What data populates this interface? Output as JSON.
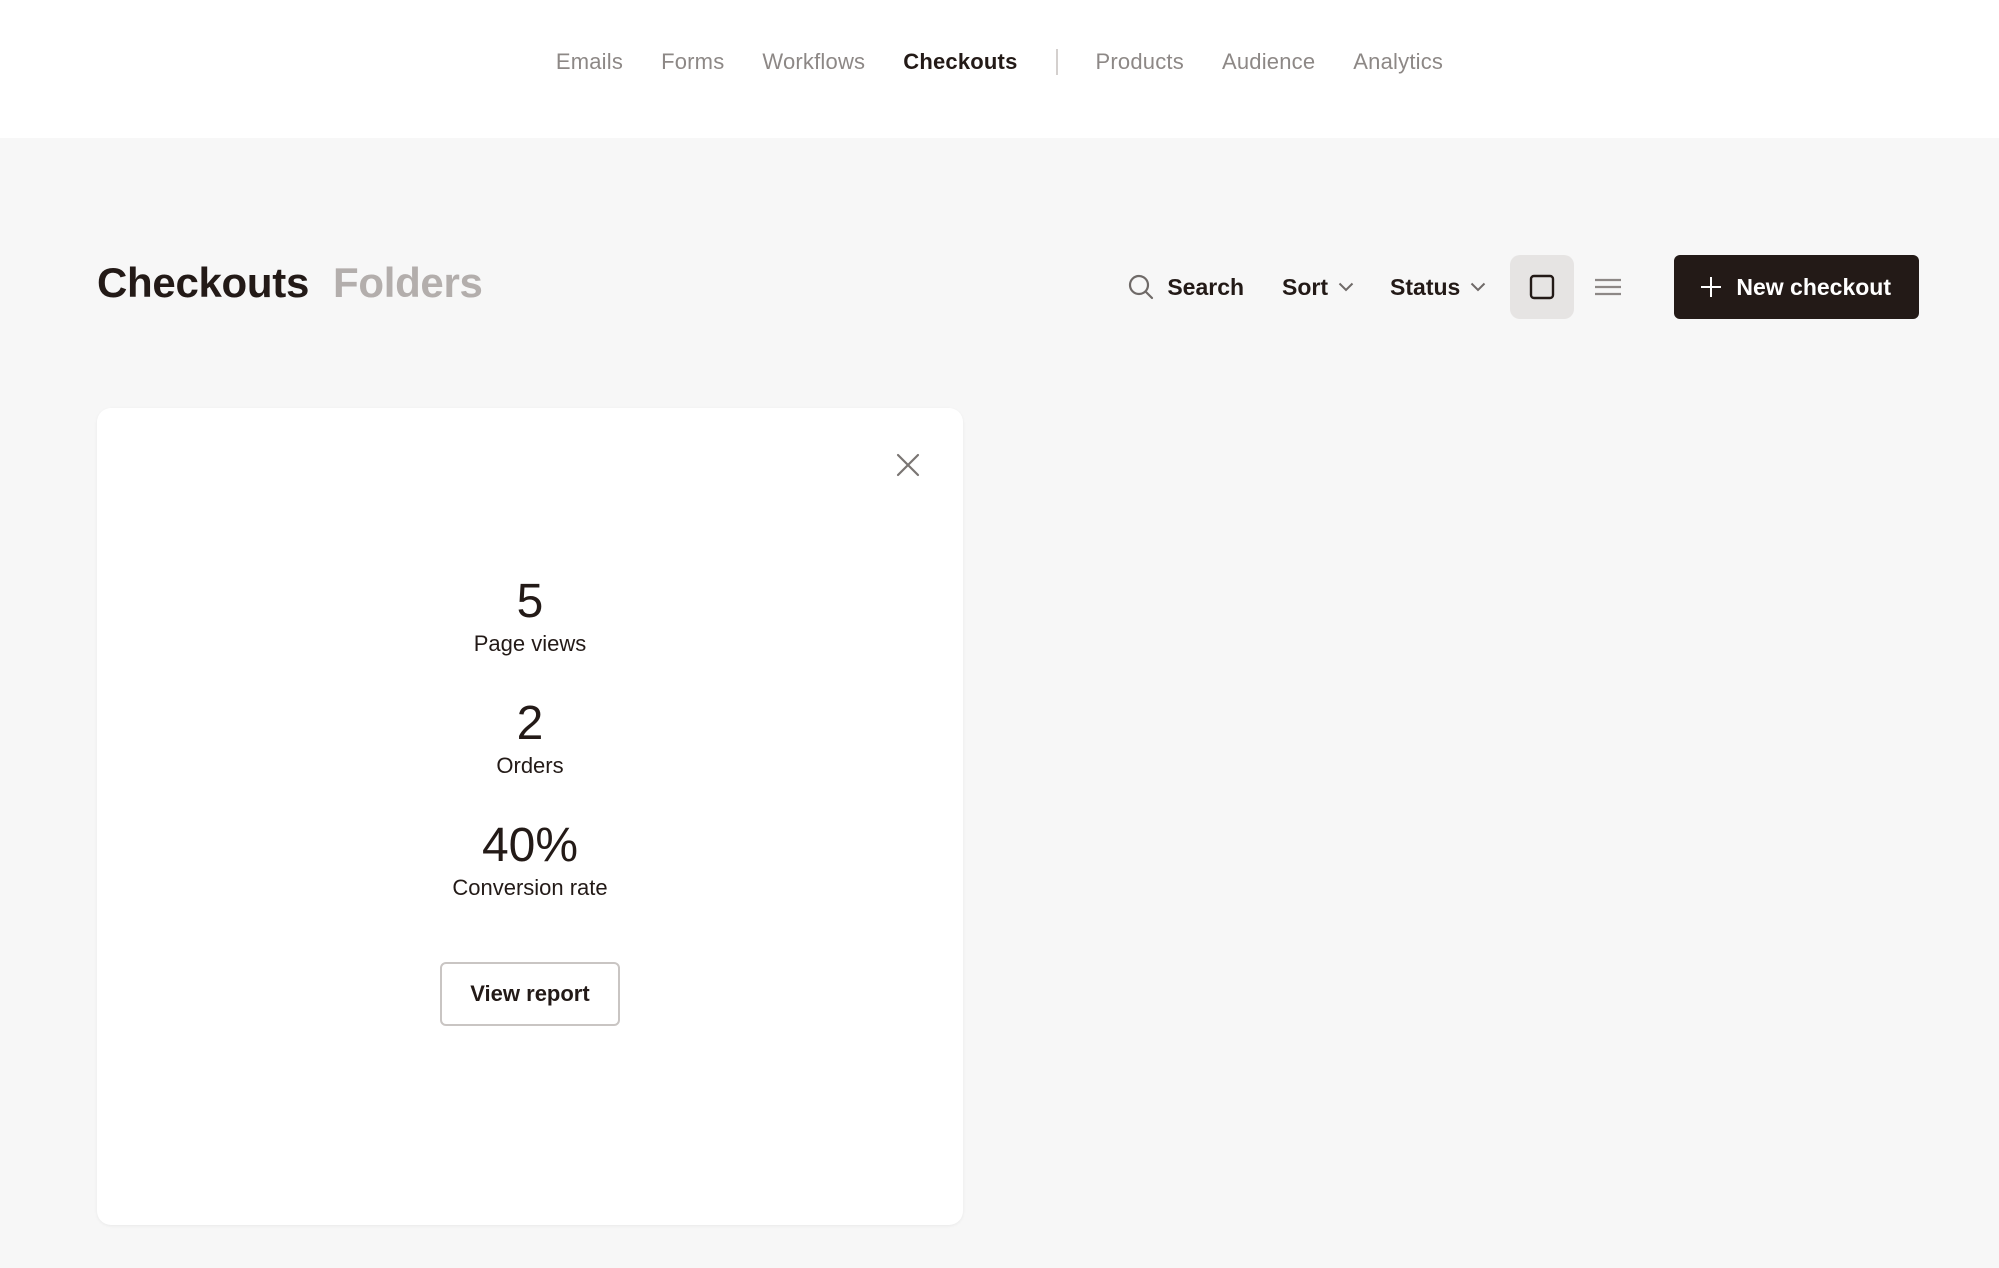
{
  "nav": {
    "items": [
      {
        "label": "Emails",
        "active": false
      },
      {
        "label": "Forms",
        "active": false
      },
      {
        "label": "Workflows",
        "active": false
      },
      {
        "label": "Checkouts",
        "active": true
      },
      {
        "label": "Products",
        "active": false
      },
      {
        "label": "Audience",
        "active": false
      },
      {
        "label": "Analytics",
        "active": false
      }
    ]
  },
  "header": {
    "tabs": [
      {
        "label": "Checkouts",
        "active": true
      },
      {
        "label": "Folders",
        "active": false
      }
    ]
  },
  "toolbar": {
    "search_label": "Search",
    "sort_label": "Sort",
    "status_label": "Status",
    "view_mode": "grid",
    "new_label": "New checkout"
  },
  "card": {
    "stats": [
      {
        "value": "5",
        "label": "Page views"
      },
      {
        "value": "2",
        "label": "Orders"
      },
      {
        "value": "40%",
        "label": "Conversion rate"
      }
    ],
    "report_label": "View report"
  },
  "colors": {
    "accent": "#231a17",
    "background": "#f7f7f7",
    "muted": "#8d8886"
  },
  "icons": [
    "search-icon",
    "chevron-down-icon",
    "grid-view-icon",
    "list-view-icon",
    "plus-icon",
    "close-icon"
  ]
}
